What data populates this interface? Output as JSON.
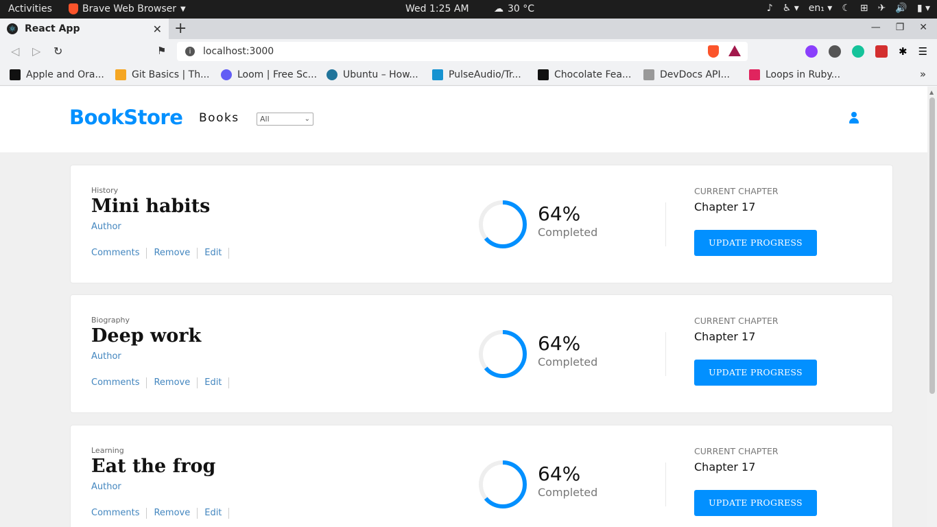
{
  "system_bar": {
    "activities": "Activities",
    "app_name": "Brave Web Browser",
    "clock": "Wed  1:25 AM",
    "weather": "30 °C",
    "language": "en₁"
  },
  "browser": {
    "tab_title": "React App",
    "url": "localhost:3000",
    "bookmarks": [
      "Apple and Ora...",
      "Git Basics | Th...",
      "Loom | Free Sc...",
      "Ubuntu – How...",
      "PulseAudio/Tr...",
      "Chocolate Fea...",
      "DevDocs API...",
      "Loops in Ruby..."
    ],
    "bookmark_colors": [
      "#111111",
      "#f5a623",
      "#625df5",
      "#21759b",
      "#1793d1",
      "#111111",
      "#999999",
      "#e0245e"
    ]
  },
  "app": {
    "logo": "BookStore",
    "nav_books": "Books",
    "filter_selected": "All",
    "brand_color": "#0290ff"
  },
  "books": [
    {
      "category": "History",
      "title": "Mini habits",
      "author": "Author",
      "actions": [
        "Comments",
        "Remove",
        "Edit"
      ],
      "progress_percent": 64,
      "progress_label": "64%",
      "completed_label": "Completed",
      "current_chapter_label": "CURRENT CHAPTER",
      "current_chapter": "Chapter 17",
      "button_label": "UPDATE PROGRESS"
    },
    {
      "category": "Biography",
      "title": "Deep work",
      "author": "Author",
      "actions": [
        "Comments",
        "Remove",
        "Edit"
      ],
      "progress_percent": 64,
      "progress_label": "64%",
      "completed_label": "Completed",
      "current_chapter_label": "CURRENT CHAPTER",
      "current_chapter": "Chapter 17",
      "button_label": "UPDATE PROGRESS"
    },
    {
      "category": "Learning",
      "title": "Eat the frog",
      "author": "Author",
      "actions": [
        "Comments",
        "Remove",
        "Edit"
      ],
      "progress_percent": 64,
      "progress_label": "64%",
      "completed_label": "Completed",
      "current_chapter_label": "CURRENT CHAPTER",
      "current_chapter": "Chapter 17",
      "button_label": "UPDATE PROGRESS"
    }
  ]
}
